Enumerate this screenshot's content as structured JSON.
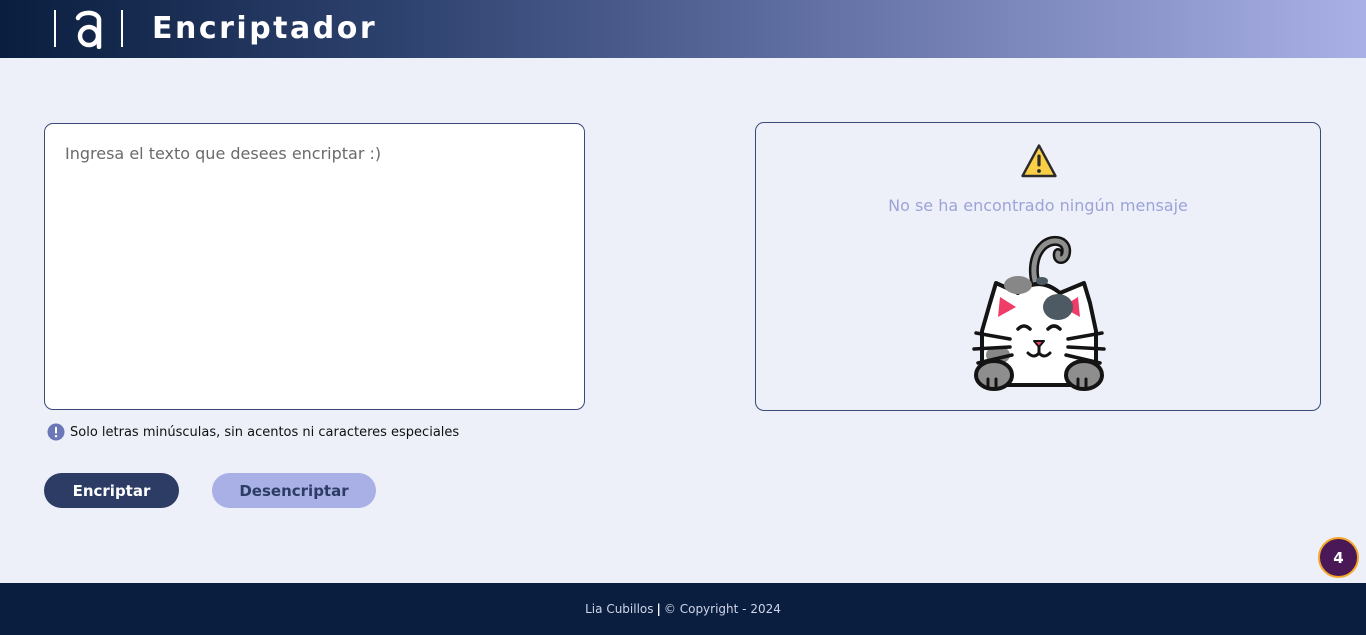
{
  "header": {
    "title": "Encriptador",
    "logo_icon": "alura-a-logo-icon"
  },
  "editor": {
    "placeholder": "Ingresa el texto que desees encriptar :)",
    "value": ""
  },
  "hint": {
    "icon": "info-exclamation-icon",
    "text": "Solo letras minúsculas, sin acentos ni caracteres especiales"
  },
  "actions": {
    "encrypt_label": "Encriptar",
    "decrypt_label": "Desencriptar"
  },
  "output": {
    "warning_icon": "warning-triangle-icon",
    "empty_message": "No se ha encontrado ningún mensaje",
    "illustration": "cat-illustration"
  },
  "badge": {
    "count": "4"
  },
  "footer": {
    "author": "Lia Cubillos",
    "separator": "|",
    "copyright": "© Copyright - 2024"
  },
  "colors": {
    "header_gradient_start": "#0A1E3F",
    "header_gradient_end": "#A9B0E6",
    "page_background": "#EEF0F9",
    "primary_button": "#2C3C64",
    "secondary_button": "#A9B0E6",
    "muted_text": "#9CA3D8",
    "footer_background": "#0A1E3F",
    "badge_fill": "#4A1856",
    "badge_ring": "#F4A629"
  }
}
